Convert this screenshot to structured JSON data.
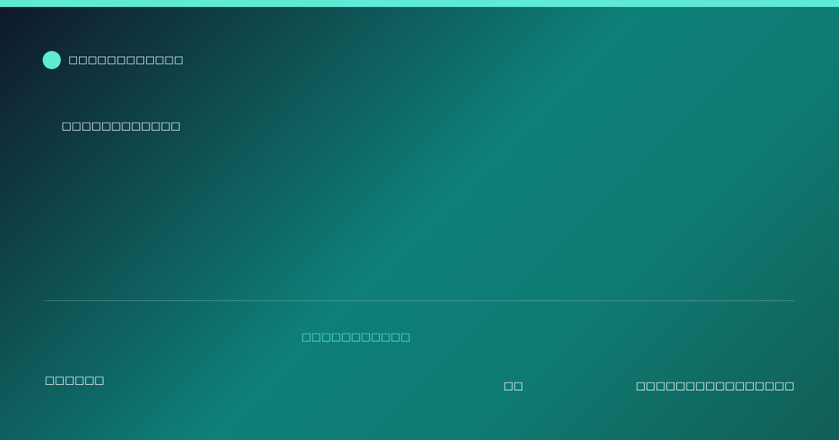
{
  "theme": {
    "accent": "#5eead4",
    "background_start": "#0f172a",
    "background_mid": "#0e8078",
    "background_end": "#115e56",
    "text": "#ffffff"
  },
  "header": {
    "brand_name": "□□□□□□□□□□□□"
  },
  "main": {
    "headline": "□□□□□□□□□□□□"
  },
  "footer": {
    "tagline": "□□□□□□□□□□□",
    "left_text": "□□□□□□",
    "middle_text": "□□",
    "right_text": "□□□□□□□□□□□□□□□□"
  }
}
